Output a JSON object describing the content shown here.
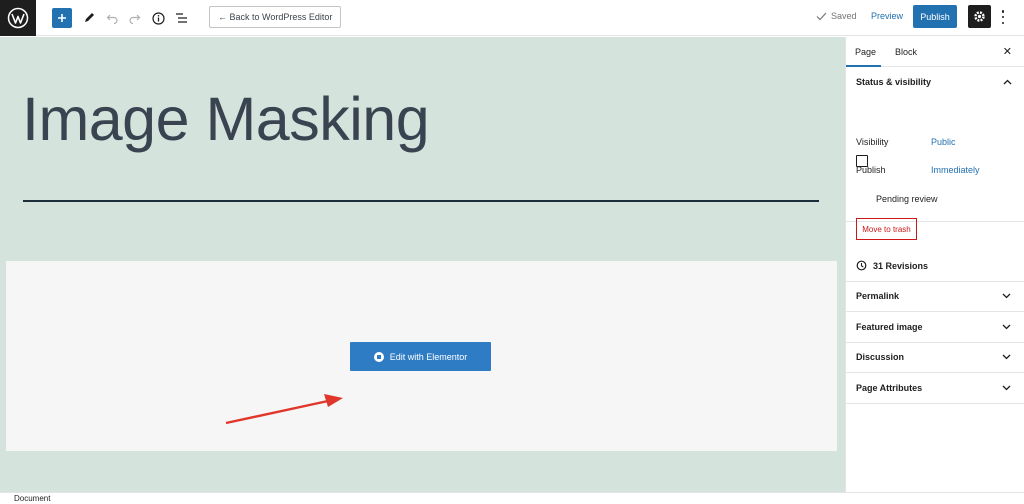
{
  "toolbar": {
    "back_label": "← Back to WordPress Editor",
    "saved_label": "Saved",
    "preview_label": "Preview",
    "publish_label": "Publish"
  },
  "canvas": {
    "title": "Image Masking",
    "edit_button_label": "Edit with Elementor"
  },
  "sidebar": {
    "tabs": [
      "Page",
      "Block"
    ],
    "status_section": {
      "title": "Status & visibility",
      "visibility_label": "Visibility",
      "visibility_value": "Public",
      "publish_label": "Publish",
      "publish_value": "Immediately",
      "pending_label": "Pending review",
      "trash_label": "Move to trash"
    },
    "revisions_label": "31 Revisions",
    "sections": [
      "Permalink",
      "Featured image",
      "Discussion",
      "Page Attributes"
    ]
  },
  "footer": {
    "label": "Document"
  },
  "colors": {
    "accent": "#2271b1",
    "canvas_bg": "#d4e4dc",
    "danger": "#cc1818",
    "annotation_arrow": "#e0362c"
  }
}
